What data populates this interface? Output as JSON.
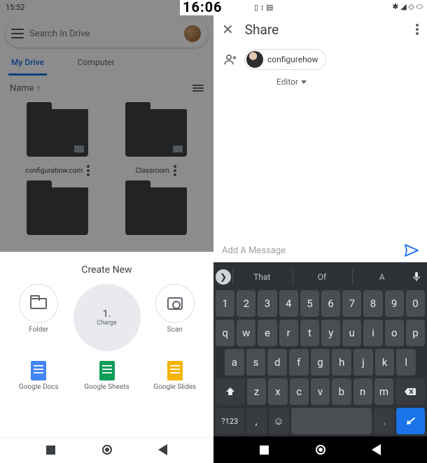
{
  "left": {
    "status": {
      "time": "15:52"
    },
    "search": {
      "placeholder": "Search In Drive"
    },
    "tabs": {
      "active": "My Drive",
      "inactive": "Computer"
    },
    "sort": {
      "label": "Name",
      "arrow": "↑"
    },
    "folders": [
      {
        "name": "configurehow.com"
      },
      {
        "name": "Classroom"
      }
    ],
    "sheet": {
      "title": "Create New",
      "items": {
        "folder": "Folder",
        "charge": "Charge",
        "chargeNum": "1.",
        "scan": "Scan",
        "docs": "Google Docs",
        "sheets": "Google Sheets",
        "slides": "Google Slides"
      }
    }
  },
  "right": {
    "clock": "16:06",
    "share": {
      "title": "Share",
      "chip": "configurehow",
      "role": "Editor",
      "message_placeholder": "Add A Message"
    },
    "kb": {
      "suggestions": [
        "That",
        "Of",
        "A"
      ],
      "row1": [
        "1",
        "2",
        "3",
        "4",
        "5",
        "6",
        "7",
        "8",
        "9",
        "0"
      ],
      "row2": [
        "q",
        "w",
        "e",
        "r",
        "t",
        "y",
        "u",
        "i",
        "o",
        "p"
      ],
      "row3": [
        "a",
        "s",
        "d",
        "f",
        "g",
        "h",
        "j",
        "k",
        "l"
      ],
      "row4_mid": [
        "z",
        "x",
        "c",
        "v",
        "b",
        "n",
        "m"
      ],
      "num": "?123",
      "comma": ",",
      "period": "."
    }
  }
}
